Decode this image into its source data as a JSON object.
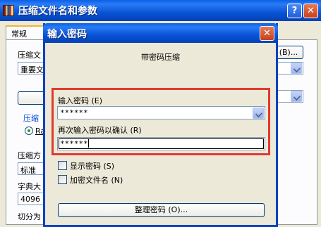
{
  "back_window": {
    "title": "压缩文件名和参数",
    "help_icon": "question-mark-icon",
    "close_icon": "close-icon",
    "tabs": [
      {
        "label": "常规"
      }
    ],
    "labels": {
      "archive_name": "压缩文",
      "compression_method": "压缩方",
      "dictionary_size": "字典大",
      "split_volumes": "切分为",
      "compression_format_group": "压缩",
      "format_radio": "Ra"
    },
    "combos": {
      "archive_name_value": "重要文",
      "compression_method_value": "标准",
      "dictionary_size_value": "4096"
    },
    "browse_button_label": "(B)..."
  },
  "password_dialog": {
    "title": "输入密码",
    "close_icon": "close-icon",
    "subtitle": "带密码压缩",
    "enter_password_label": "输入密码 (E)",
    "enter_password_value": "******",
    "confirm_password_label": "再次输入密码以确认 (R)",
    "confirm_password_value": "******",
    "show_password_label": "显示密码 (S)",
    "show_password_checked": false,
    "encrypt_filenames_label": "加密文件名 (N)",
    "encrypt_filenames_checked": false,
    "organize_passwords_button": "整理密码 (O)...",
    "highlight_color": "#E03A2F"
  },
  "colors": {
    "titlebar": "#0A60E8",
    "dialog_bg": "#ECE9D8"
  }
}
